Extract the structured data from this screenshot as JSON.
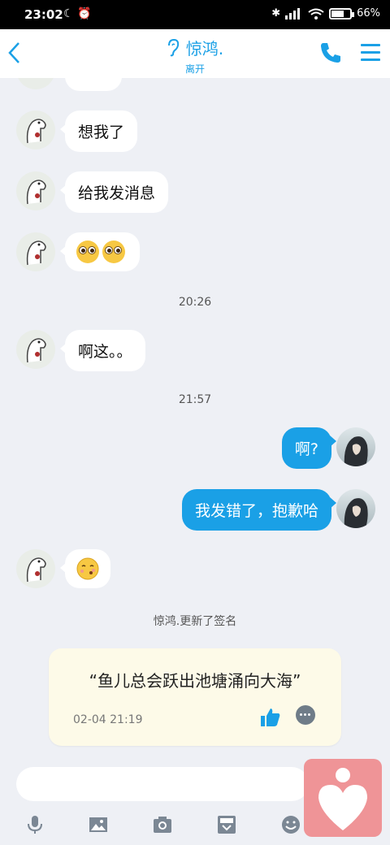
{
  "status_bar": {
    "time": "23:02",
    "battery": "66",
    "battery_fraction": 0.66
  },
  "header": {
    "title": "惊鸿.",
    "subtitle": "离开"
  },
  "messages": [
    {
      "side": "left",
      "text": "想我了"
    },
    {
      "side": "left",
      "text": "给我发消息"
    },
    {
      "side": "left",
      "type": "emoji",
      "emoji": "pleading-face-emoji x2"
    },
    {
      "side": "time",
      "text": "20:26"
    },
    {
      "side": "left",
      "text": "啊这。。"
    },
    {
      "side": "time",
      "text": "21:57"
    },
    {
      "side": "right",
      "text": "啊?"
    },
    {
      "side": "right",
      "text": "我发错了，抱歉哈"
    },
    {
      "side": "left",
      "type": "emoji",
      "emoji": "shy-face-emoji"
    },
    {
      "side": "system",
      "text": "惊鸿.更新了签名"
    }
  ],
  "signature_card": {
    "text": "“鱼儿总会跃出池塘涌向大海”",
    "date": "02-04 21:19"
  },
  "colors": {
    "accent": "#1aa0e6",
    "background": "#eef0f5",
    "card": "#fdfae8",
    "fab": "#ef9497"
  },
  "icons": [
    "back-icon",
    "ear-icon",
    "phone-icon",
    "menu-icon",
    "like-icon",
    "comment-icon",
    "mic-icon",
    "image-icon",
    "camera-icon",
    "inbox-icon",
    "smiley-icon",
    "heart-icon"
  ]
}
